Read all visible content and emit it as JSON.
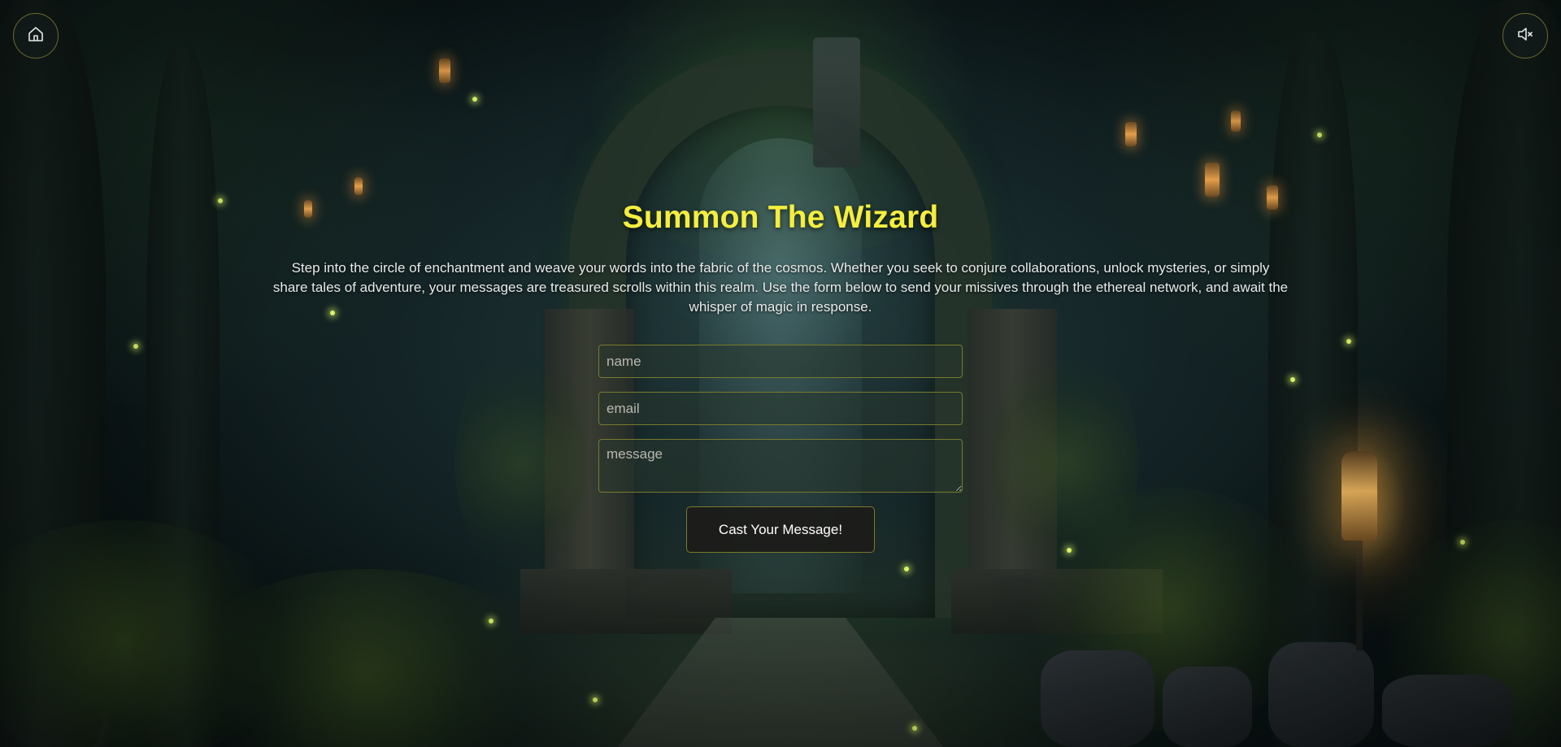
{
  "page": {
    "title": "Summon The Wizard",
    "description": "Step into the circle of enchantment and weave your words into the fabric of the cosmos. Whether you seek to conjure collaborations, unlock mysteries, or simply share tales of adventure, your messages are treasured scrolls within this realm. Use the form below to send your missives through the ethereal network, and await the whisper of magic in response."
  },
  "nav": {
    "home_icon": "home-icon",
    "sound_icon": "volume-muted-icon"
  },
  "form": {
    "name": {
      "placeholder": "name",
      "value": ""
    },
    "email": {
      "placeholder": "email",
      "value": ""
    },
    "message": {
      "placeholder": "message",
      "value": ""
    },
    "submit_label": "Cast Your Message!"
  },
  "colors": {
    "title": "#f4ee3e",
    "border_accent": "#7a7a2e",
    "text": "#e8eaea"
  }
}
